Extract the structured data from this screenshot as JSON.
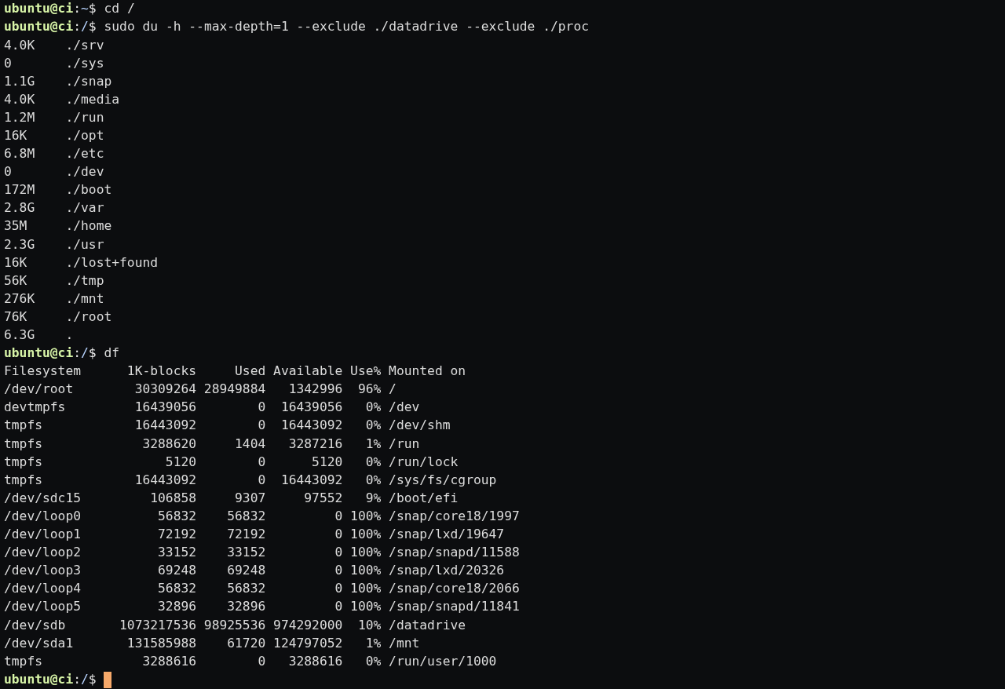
{
  "lines": [
    {
      "kind": "prompt",
      "user": "ubuntu@ci",
      "sep": ":",
      "path": "~",
      "symbol": "$",
      "command": "cd /",
      "cursor": false
    },
    {
      "kind": "prompt",
      "user": "ubuntu@ci",
      "sep": ":",
      "path": "/",
      "symbol": "$",
      "command": "sudo du -h --max-depth=1 --exclude ./datadrive --exclude ./proc",
      "cursor": false
    },
    {
      "kind": "output",
      "text": "4.0K    ./srv"
    },
    {
      "kind": "output",
      "text": "0       ./sys"
    },
    {
      "kind": "output",
      "text": "1.1G    ./snap"
    },
    {
      "kind": "output",
      "text": "4.0K    ./media"
    },
    {
      "kind": "output",
      "text": "1.2M    ./run"
    },
    {
      "kind": "output",
      "text": "16K     ./opt"
    },
    {
      "kind": "output",
      "text": "6.8M    ./etc"
    },
    {
      "kind": "output",
      "text": "0       ./dev"
    },
    {
      "kind": "output",
      "text": "172M    ./boot"
    },
    {
      "kind": "output",
      "text": "2.8G    ./var"
    },
    {
      "kind": "output",
      "text": "35M     ./home"
    },
    {
      "kind": "output",
      "text": "2.3G    ./usr"
    },
    {
      "kind": "output",
      "text": "16K     ./lost+found"
    },
    {
      "kind": "output",
      "text": "56K     ./tmp"
    },
    {
      "kind": "output",
      "text": "276K    ./mnt"
    },
    {
      "kind": "output",
      "text": "76K     ./root"
    },
    {
      "kind": "output",
      "text": "6.3G    ."
    },
    {
      "kind": "prompt",
      "user": "ubuntu@ci",
      "sep": ":",
      "path": "/",
      "symbol": "$",
      "command": "df",
      "cursor": false
    },
    {
      "kind": "output",
      "text": "Filesystem      1K-blocks     Used Available Use% Mounted on"
    },
    {
      "kind": "output",
      "text": "/dev/root        30309264 28949884   1342996  96% /"
    },
    {
      "kind": "output",
      "text": "devtmpfs         16439056        0  16439056   0% /dev"
    },
    {
      "kind": "output",
      "text": "tmpfs            16443092        0  16443092   0% /dev/shm"
    },
    {
      "kind": "output",
      "text": "tmpfs             3288620     1404   3287216   1% /run"
    },
    {
      "kind": "output",
      "text": "tmpfs                5120        0      5120   0% /run/lock"
    },
    {
      "kind": "output",
      "text": "tmpfs            16443092        0  16443092   0% /sys/fs/cgroup"
    },
    {
      "kind": "output",
      "text": "/dev/sdc15         106858     9307     97552   9% /boot/efi"
    },
    {
      "kind": "output",
      "text": "/dev/loop0          56832    56832         0 100% /snap/core18/1997"
    },
    {
      "kind": "output",
      "text": "/dev/loop1          72192    72192         0 100% /snap/lxd/19647"
    },
    {
      "kind": "output",
      "text": "/dev/loop2          33152    33152         0 100% /snap/snapd/11588"
    },
    {
      "kind": "output",
      "text": "/dev/loop3          69248    69248         0 100% /snap/lxd/20326"
    },
    {
      "kind": "output",
      "text": "/dev/loop4          56832    56832         0 100% /snap/core18/2066"
    },
    {
      "kind": "output",
      "text": "/dev/loop5          32896    32896         0 100% /snap/snapd/11841"
    },
    {
      "kind": "output",
      "text": "/dev/sdb       1073217536 98925536 974292000  10% /datadrive"
    },
    {
      "kind": "output",
      "text": "/dev/sda1       131585988    61720 124797052   1% /mnt"
    },
    {
      "kind": "output",
      "text": "tmpfs             3288616        0   3288616   0% /run/user/1000"
    },
    {
      "kind": "prompt",
      "user": "ubuntu@ci",
      "sep": ":",
      "path": "/",
      "symbol": "$",
      "cursor": true
    }
  ]
}
